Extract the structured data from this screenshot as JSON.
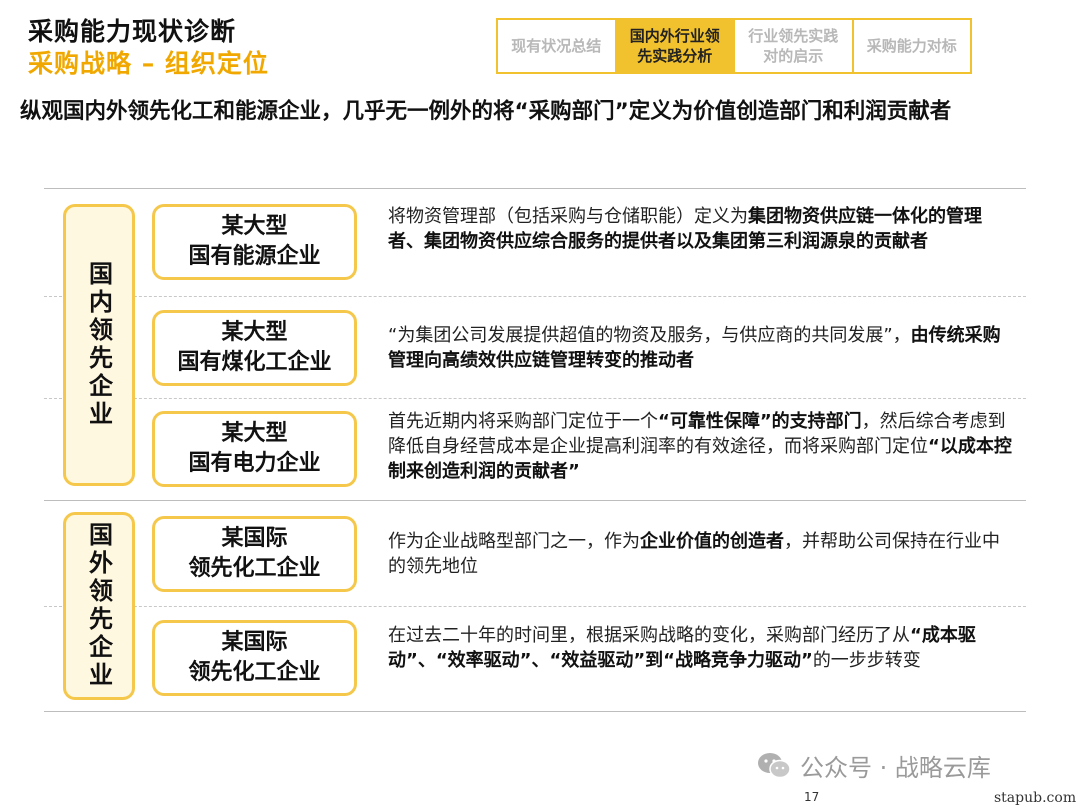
{
  "header": {
    "title": "采购能力现状诊断",
    "subtitle": "采购战略 – 组织定位"
  },
  "nav_tabs": [
    {
      "label": "现有状况总结",
      "active": false
    },
    {
      "label": "国内外行业领\n先实践分析",
      "active": true
    },
    {
      "label": "行业领先实践\n对的启示",
      "active": false
    },
    {
      "label": "采购能力对标",
      "active": false
    }
  ],
  "headline": "纵观国内外领先化工和能源企业，几乎无一例外的将“采购部门”定义为价值创造部门和利润贡献者",
  "groups": {
    "domestic": "国内领先企业",
    "foreign": "国外领先企业"
  },
  "rows": [
    {
      "entity_line1": "某大型",
      "entity_line2": "国有能源企业",
      "segments": [
        {
          "text": "将物资管理部（包括采购与仓储职能）定义为",
          "bold": false
        },
        {
          "text": "集团物资供应链一体化的管理者、集团物资供应综合服务的提供者以及集团第三利润源泉的贡献者",
          "bold": true
        }
      ]
    },
    {
      "entity_line1": "某大型",
      "entity_line2": "国有煤化工企业",
      "segments": [
        {
          "text": "“为集团公司发展提供超值的物资及服务，与供应商的共同发展”，",
          "bold": false
        },
        {
          "text": "由传统采购管理向高绩效供应链管理转变的推动者",
          "bold": true
        }
      ]
    },
    {
      "entity_line1": "某大型",
      "entity_line2": "国有电力企业",
      "segments": [
        {
          "text": "首先近期内将采购部门定位于一个",
          "bold": false
        },
        {
          "text": "“可靠性保障”的支持部门",
          "bold": true
        },
        {
          "text": "，然后综合考虑到降低自身经营成本是企业提高利润率的有效途径，而将采购部门定位",
          "bold": false
        },
        {
          "text": "“以成本控制来创造利润的贡献者”",
          "bold": true
        }
      ]
    },
    {
      "entity_line1": "某国际",
      "entity_line2": "领先化工企业",
      "segments": [
        {
          "text": "作为企业战略型部门之一，作为",
          "bold": false
        },
        {
          "text": "企业价值的创造者",
          "bold": true
        },
        {
          "text": "，并帮助公司保持在行业中的领先地位",
          "bold": false
        }
      ]
    },
    {
      "entity_line1": "某国际",
      "entity_line2": "领先化工企业",
      "segments": [
        {
          "text": "在过去二十年的时间里，根据采购战略的变化，采购部门经历了从",
          "bold": false
        },
        {
          "text": "“成本驱动”、“效率驱动”、“效益驱动”到“战略竞争力驱动”",
          "bold": true
        },
        {
          "text": "的一步步转变",
          "bold": false
        }
      ]
    }
  ],
  "watermark": "公众号 · 战略云库",
  "page_number": "17",
  "site": "stapub.com",
  "colors": {
    "accent": "#f2c22e",
    "box_border": "#f5c84c",
    "subtitle": "#f0a800"
  }
}
